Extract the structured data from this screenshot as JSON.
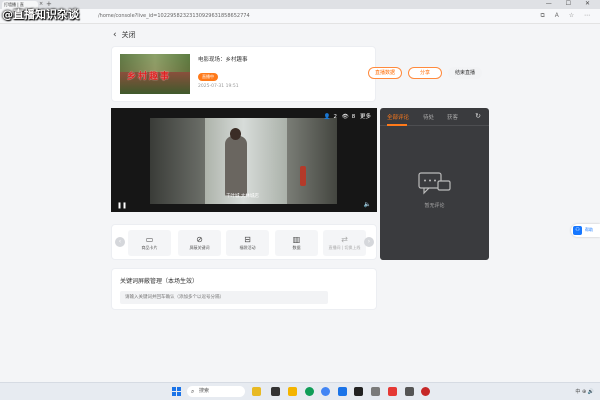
{
  "watermark": "@直播知识杂谈",
  "browser": {
    "tab_title": "打墙播 | 直",
    "tab_close": "×",
    "tab_new": "+",
    "window_controls": "— ☐ ✕",
    "url": "/home/console?live_id=10229582323130929631858652774",
    "address_icons": "⧉ A ☆ ⋯"
  },
  "page": {
    "back_label": "关闭",
    "live": {
      "thumb_text": "乡村趣事",
      "title": "电影现场：乡村趣事",
      "badge": "直播中",
      "time": "2025-07-31 19:51",
      "buttons": [
        "直播数据",
        "分享",
        "结束直播"
      ]
    },
    "video": {
      "viewers": "2",
      "views": "8",
      "more": "更多",
      "subtitle": "千叶城   大林城店"
    },
    "comments": {
      "tabs": [
        "全部评论",
        "待处",
        "获客"
      ],
      "empty_text": "暂无评论"
    },
    "tools": [
      "商品卡片",
      "屏蔽关键词",
      "福袋活动",
      "数据",
      "直播间 | 切换上线"
    ],
    "keywords": {
      "title": "关键词屏蔽管理（本场生效）",
      "placeholder": "请输入关键词并回车确认（添加多个以逗号分隔）"
    },
    "side_float": "帮助"
  },
  "taskbar": {
    "search_placeholder": "搜索",
    "tray_text": "中  ⊕  🔊"
  }
}
